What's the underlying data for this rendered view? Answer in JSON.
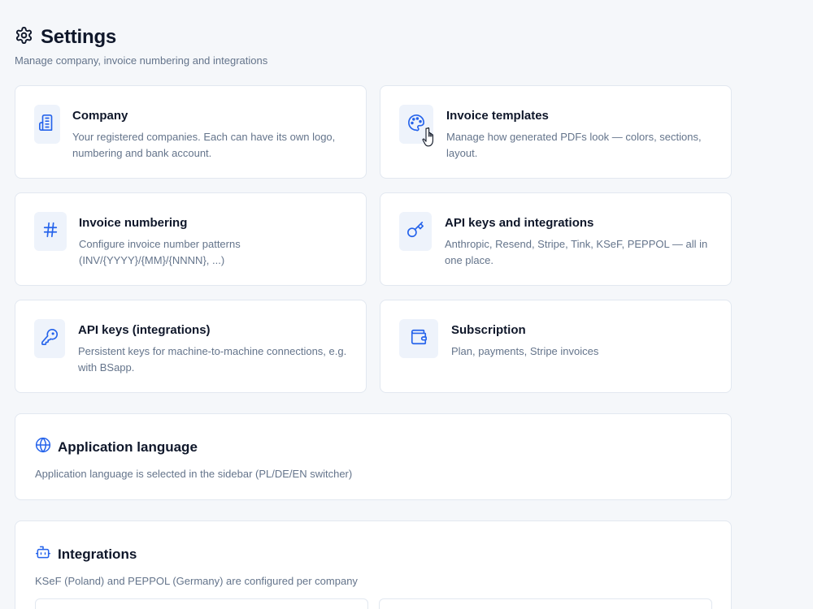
{
  "header": {
    "title": "Settings",
    "subtitle": "Manage company, invoice numbering and integrations"
  },
  "cards": {
    "company": {
      "title": "Company",
      "description": "Your registered companies. Each can have its own logo, numbering and bank account.",
      "icon": "building-icon"
    },
    "invoice_templates": {
      "title": "Invoice templates",
      "description": "Manage how generated PDFs look — colors, sections, layout.",
      "icon": "palette-icon"
    },
    "invoice_numbering": {
      "title": "Invoice numbering",
      "description": "Configure invoice number patterns (INV/{YYYY}/{MM}/{NNNN}, ...)",
      "icon": "hash-icon"
    },
    "api_keys_integrations": {
      "title": "API keys and integrations",
      "description": "Anthropic, Resend, Stripe, Tink, KSeF, PEPPOL — all in one place.",
      "icon": "key-icon"
    },
    "api_keys": {
      "title": "API keys (integrations)",
      "description": "Persistent keys for machine-to-machine connections, e.g. with BSapp.",
      "icon": "key-round-icon"
    },
    "subscription": {
      "title": "Subscription",
      "description": "Plan, payments, Stripe invoices",
      "icon": "wallet-icon"
    }
  },
  "sections": {
    "language": {
      "title": "Application language",
      "description": "Application language is selected in the sidebar (PL/DE/EN switcher)",
      "icon": "globe-icon"
    },
    "integrations": {
      "title": "Integrations",
      "description": "KSeF (Poland) and PEPPOL (Germany) are configured per company",
      "icon": "bot-icon"
    }
  },
  "colors": {
    "accent": "#2563eb",
    "icon_bg": "#eef3fb",
    "background": "#f5f7fa",
    "border": "#e2e8f0",
    "muted_text": "#64748b",
    "heading": "#0f172a"
  }
}
